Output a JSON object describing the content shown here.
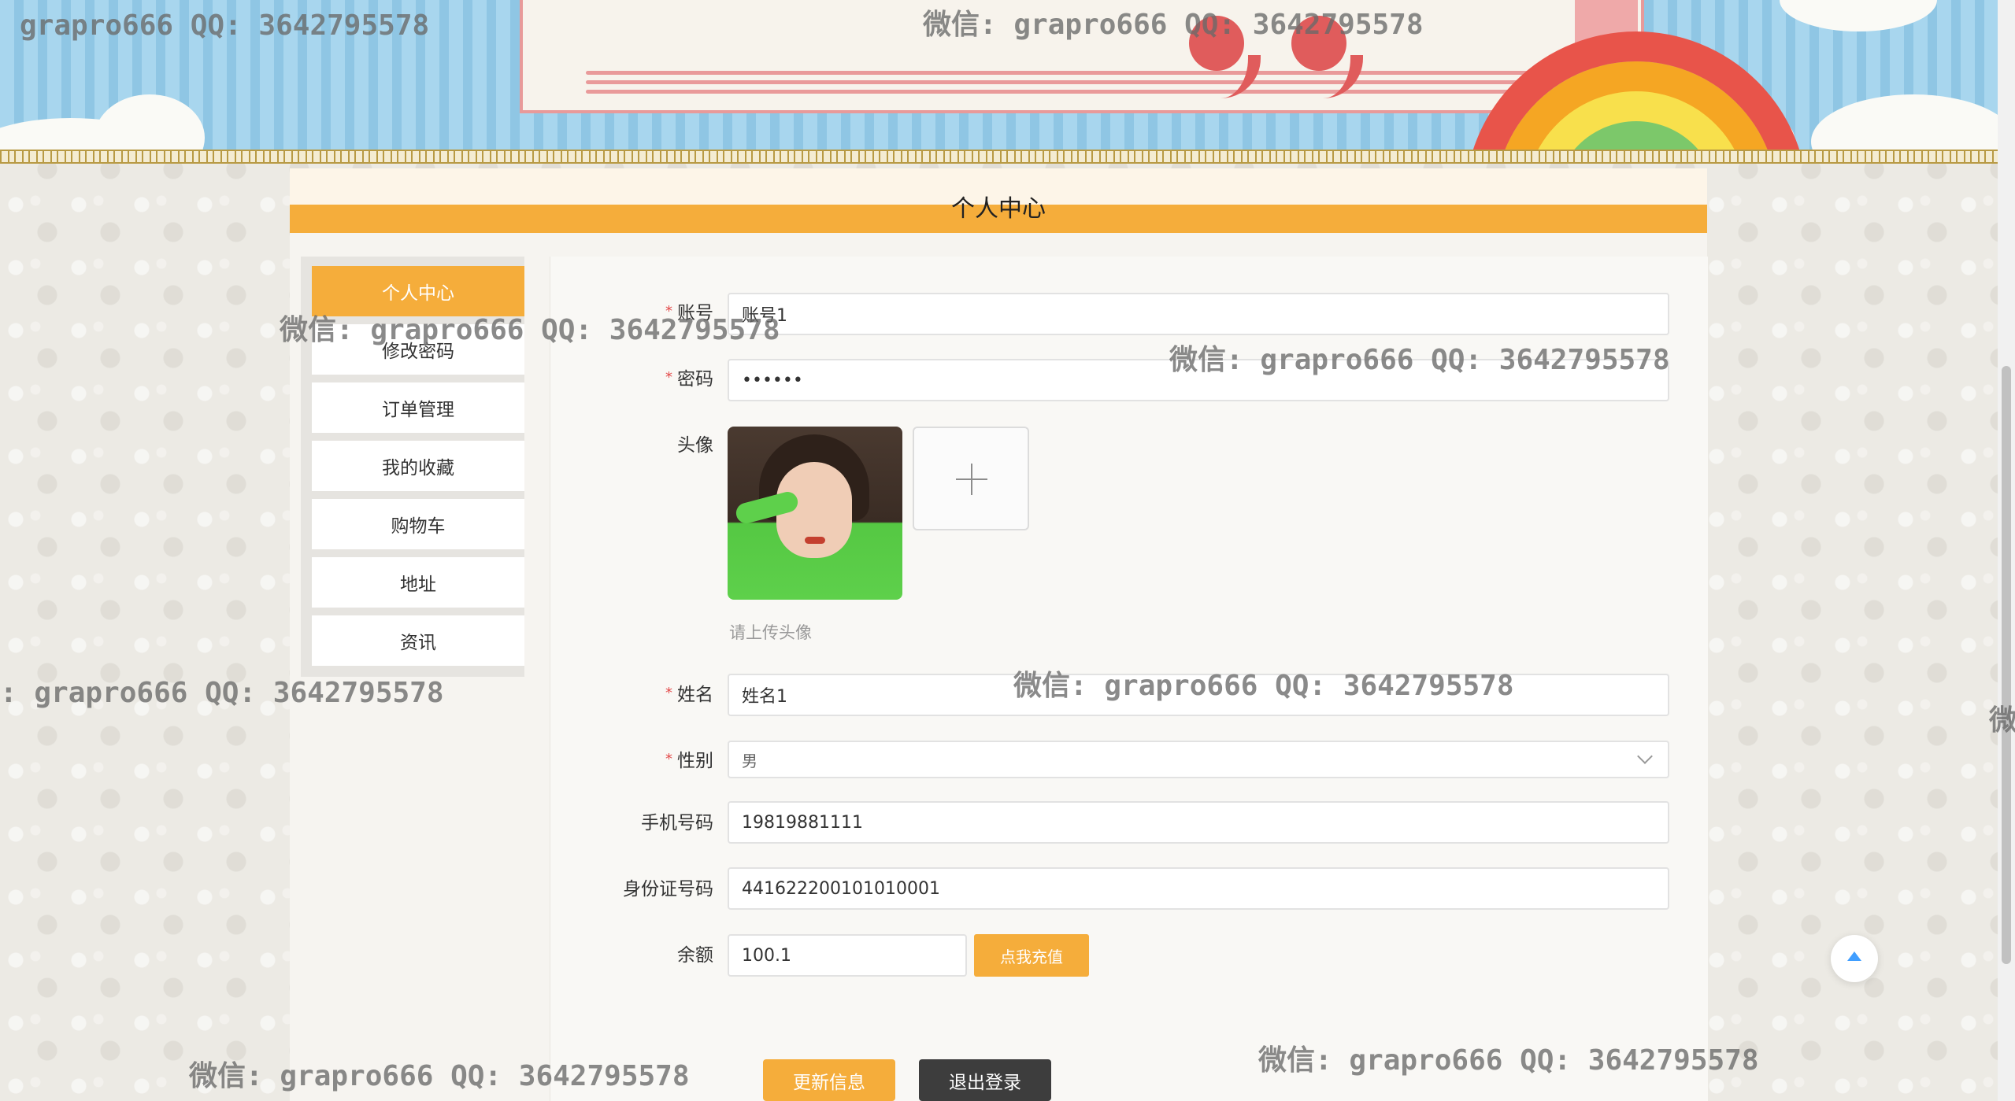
{
  "page": {
    "title": "个人中心"
  },
  "sidebar": {
    "items": [
      {
        "label": "个人中心",
        "active": true
      },
      {
        "label": "修改密码",
        "active": false
      },
      {
        "label": "订单管理",
        "active": false
      },
      {
        "label": "我的收藏",
        "active": false
      },
      {
        "label": "购物车",
        "active": false
      },
      {
        "label": "地址",
        "active": false
      },
      {
        "label": "资讯",
        "active": false
      }
    ]
  },
  "form": {
    "account": {
      "label": "账号",
      "required": true,
      "value": "账号1"
    },
    "password": {
      "label": "密码",
      "required": true,
      "value": "••••••"
    },
    "avatar": {
      "label": "头像",
      "hint": "请上传头像"
    },
    "name": {
      "label": "姓名",
      "required": true,
      "value": "姓名1"
    },
    "gender": {
      "label": "性别",
      "required": true,
      "value": "男"
    },
    "phone": {
      "label": "手机号码",
      "value": "19819881111"
    },
    "id_card": {
      "label": "身份证号码",
      "value": "441622200101010001"
    },
    "balance": {
      "label": "余额",
      "value": "100.1",
      "recharge_label": "点我充值"
    }
  },
  "actions": {
    "update_label": "更新信息",
    "logout_label": "退出登录"
  },
  "watermark": {
    "line1": "grapro666 QQ: 3642795578",
    "line2": "微信: grapro666 QQ: 3642795578",
    "line3": ": grapro666 QQ: 3642795578",
    "line4": "微"
  },
  "colors": {
    "accent": "#f5ad3b",
    "dark_button": "#3d3d3d",
    "required_star": "#e34a4a",
    "back_top_arrow": "#409eff"
  },
  "icons": {
    "upload": "plus-icon",
    "select": "chevron-down-icon",
    "back_to_top": "caret-up-icon"
  }
}
